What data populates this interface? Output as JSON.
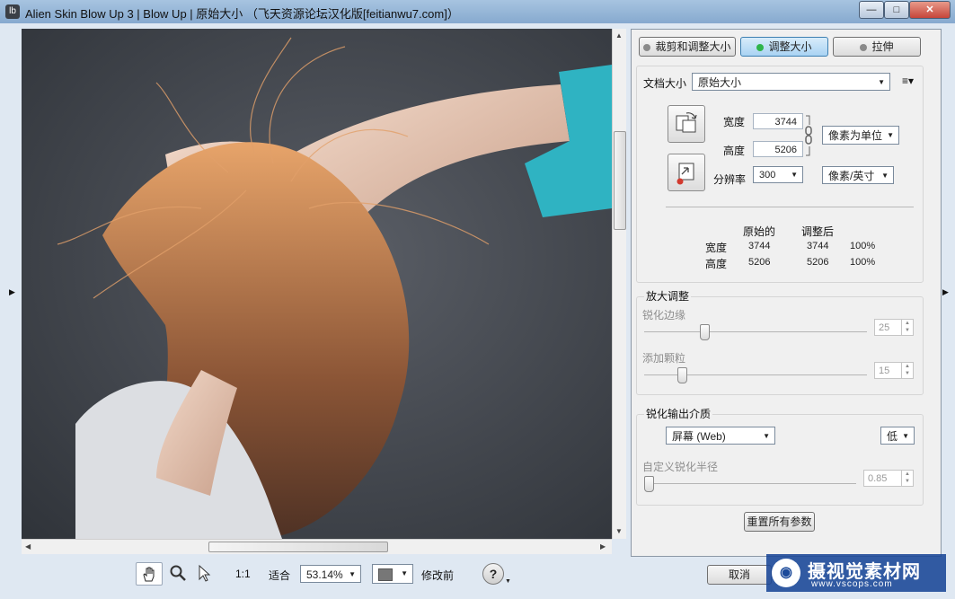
{
  "window": {
    "title": "Alien Skin Blow Up 3 | Blow Up | 原始大小 （飞天资源论坛汉化版[feitianwu7.com]）",
    "app_icon_text": "lb",
    "minimize": "—",
    "maximize": "□",
    "close": "✕"
  },
  "toolbar": {
    "hand_tool": "hand-icon",
    "zoom_tool": "magnifier-icon",
    "select_tool": "arrow-icon",
    "one_to_one": "1:1",
    "fit_label": "适合",
    "zoom_value": "53.14%",
    "preview_mode": "修改前",
    "help": "?",
    "cancel_label": "取消"
  },
  "tabs": [
    {
      "label": "裁剪和调整大小",
      "active": false
    },
    {
      "label": "调整大小",
      "active": true
    },
    {
      "label": "拉伸",
      "active": false
    }
  ],
  "doc_size": {
    "label": "文档大小",
    "value": "原始大小",
    "menu_icon": "≡▾"
  },
  "dimensions": {
    "width_label": "宽度",
    "width_value": "3744",
    "height_label": "高度",
    "height_value": "5206",
    "unit_value": "像素为单位",
    "resolution_label": "分辨率",
    "resolution_value": "300",
    "resolution_unit": "像素/英寸"
  },
  "summary": {
    "col_original": "原始的",
    "col_adjusted": "调整后",
    "rows": [
      {
        "label": "宽度",
        "original": "3744",
        "adjusted": "3744",
        "percent": "100%"
      },
      {
        "label": "高度",
        "original": "5206",
        "adjusted": "5206",
        "percent": "100%"
      }
    ]
  },
  "enlarge": {
    "title": "放大调整",
    "sharpen_label": "锐化边缘",
    "sharpen_value": "25",
    "sharpen_level": 0.25,
    "grain_label": "添加颗粒",
    "grain_value": "15",
    "grain_level": 0.15
  },
  "output": {
    "title": "锐化输出介质",
    "media_value": "屏幕 (Web)",
    "amount_value": "低",
    "radius_label": "自定义锐化半径",
    "radius_value": "0.85",
    "radius_level": 0.0
  },
  "reset_label": "重置所有参数",
  "watermark": {
    "logo_text": "摄视觉素材网",
    "url": "www.vscops.com"
  },
  "colors": {
    "accent": "#a9d3f3",
    "active_dot": "#2fb54b",
    "title_bar": "#a7c4e0"
  }
}
